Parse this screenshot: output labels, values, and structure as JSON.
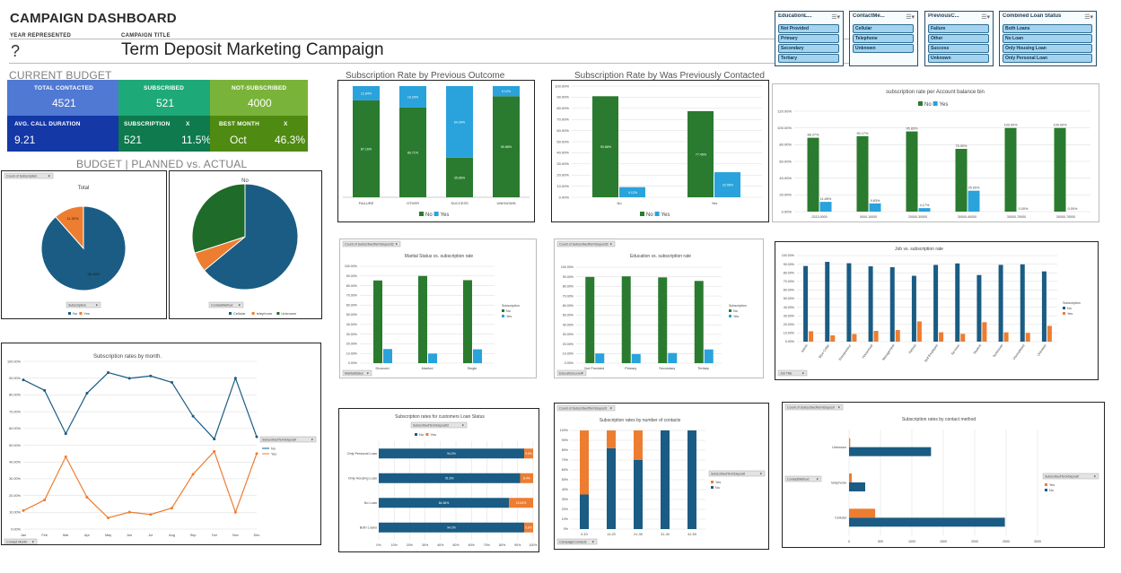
{
  "header": {
    "title": "CAMPAIGN DASHBOARD",
    "year_label": "YEAR REPRESENTED",
    "year_value": "?",
    "campaign_label": "CAMPAIGN TITLE",
    "campaign_value": "Term Deposit Marketing Campaign"
  },
  "colors": {
    "green": "#2a7b2f",
    "blue": "#2aa2db",
    "navy": "#1a5c83",
    "orange": "#ed7d31"
  },
  "current_budget": {
    "title": "CURRENT BUDGET",
    "tiles": [
      {
        "label": "TOTAL CONTACTED",
        "value": "4521"
      },
      {
        "label": "SUBSCRIBED",
        "value": "521"
      },
      {
        "label": "NOT-SUBSCRIBED",
        "value": "4000"
      },
      {
        "label": "AVG. CALL DURATION",
        "value": "9.21"
      },
      {
        "label": "SUBSCRIPTION",
        "extra": "X",
        "value": "521",
        "value2": "11.5%"
      },
      {
        "label": "BEST MONTH",
        "extra": "X",
        "value": "Oct",
        "value2": "46.3%"
      }
    ]
  },
  "budget_section": {
    "title": "BUDGET  |  PLANNED vs. ACTUAL"
  },
  "slicers": [
    {
      "title": "EducationL...",
      "items": [
        "Not Provided",
        "Primary",
        "Secondary",
        "Tertiary"
      ]
    },
    {
      "title": "ContactMe...",
      "items": [
        "Cellular",
        "Telephone",
        "Unknown"
      ]
    },
    {
      "title": "PreviousC...",
      "items": [
        "Failure",
        "Other",
        "Success",
        "Unknown"
      ]
    },
    {
      "title": "Combined Loan Status",
      "items": [
        "Both Loans",
        "No Loan",
        "Only Housing Loan",
        "Only Personal Loan"
      ]
    }
  ],
  "chart_data": [
    {
      "id": "pie-total",
      "type": "pie",
      "title": "Total",
      "field": "Count of Subscription",
      "filter": "Subscription",
      "slices": [
        {
          "name": "No",
          "value": 88.48,
          "label": "88.48%"
        },
        {
          "name": "Yes",
          "value": 11.52,
          "label": "11.52%"
        }
      ],
      "legend": [
        "No",
        "Yes"
      ]
    },
    {
      "id": "pie-no",
      "type": "pie",
      "title": "No",
      "filter": "ContactMethod",
      "slices": [
        {
          "name": "Cellular",
          "value": 64
        },
        {
          "name": "telephone",
          "value": 6
        },
        {
          "name": "Unknown",
          "value": 30
        }
      ],
      "legend": [
        "Cellular",
        "telephone",
        "Unknown"
      ]
    },
    {
      "id": "prev-outcome",
      "type": "bar",
      "stacked": true,
      "title": "Subscription Rate by Previous Outcome",
      "categories": [
        "FAILURE",
        "OTHER",
        "SUCCESS",
        "UNKNOWN"
      ],
      "series": [
        {
          "name": "No",
          "values": [
            87.16,
            80.71,
            35.66,
            90.88
          ],
          "labels": [
            "87.16%",
            "80.71%",
            "35.66%",
            "90.88%"
          ]
        },
        {
          "name": "Yes",
          "values": [
            12.84,
            19.29,
            64.34,
            9.12
          ],
          "labels": [
            "12.84%",
            "19.29%",
            "64.34%",
            "9.12%"
          ]
        }
      ],
      "ylim": [
        0,
        100
      ]
    },
    {
      "id": "prev-contacted",
      "type": "bar",
      "title": "Subscription Rate by Was Previously Contacted",
      "categories": [
        "No",
        "Yes"
      ],
      "series": [
        {
          "name": "No",
          "values": [
            90.88,
            77.45
          ],
          "labels": [
            "90.88%",
            "77.45%"
          ]
        },
        {
          "name": "Yes",
          "values": [
            9.12,
            22.55
          ],
          "labels": [
            "9.12%",
            "22.55%"
          ]
        }
      ],
      "yticks": [
        "0.00%",
        "10.00%",
        "20.00%",
        "30.00%",
        "40.00%",
        "50.00%",
        "60.00%",
        "70.00%",
        "80.00%",
        "90.00%",
        "100.00%"
      ],
      "ylim": [
        0,
        100
      ]
    },
    {
      "id": "balance-bin",
      "type": "bar",
      "title": "subscription rate per Account balance bin",
      "categories": [
        "-3313-0000",
        "0000-10000",
        "20000-30000",
        "30000-40000",
        "30000-70000",
        "30000-70000"
      ],
      "series": [
        {
          "name": "No",
          "values": [
            88.27,
            90.17,
            95.83,
            75.0,
            100.0,
            100.0
          ],
          "labels": [
            "88.27%",
            "90.17%",
            "95.83%",
            "75.00%",
            "100.00%",
            "100.00%"
          ]
        },
        {
          "name": "Yes",
          "values": [
            11.65,
            9.83,
            4.17,
            25.0,
            0.0,
            0.0
          ],
          "labels": [
            "11.65%",
            "9.83%",
            "4.17%",
            "25.00%",
            "0.00%",
            "0.00%"
          ]
        }
      ],
      "yticks": [
        "0.00%",
        "20.00%",
        "40.00%",
        "60.00%",
        "80.00%",
        "100.00%",
        "120.00%"
      ],
      "ylim": [
        0,
        120
      ]
    },
    {
      "id": "marital",
      "type": "bar",
      "title": "Marital Status vs. subscription rate",
      "field": "Count of SubscribedTermDeposit2",
      "filter": "MaritalStatus",
      "legend_title": "Subscription",
      "categories": [
        "Divorced",
        "Married",
        "Single"
      ],
      "series": [
        {
          "name": "No",
          "values": [
            85.4,
            90.1,
            85.7
          ]
        },
        {
          "name": "Yes",
          "values": [
            14.6,
            9.9,
            14.3
          ]
        }
      ],
      "yticks": [
        "0.00%",
        "10.00%",
        "20.00%",
        "30.00%",
        "40.00%",
        "50.00%",
        "60.00%",
        "70.00%",
        "80.00%",
        "90.00%",
        "100.00%"
      ],
      "ylim": [
        0,
        100
      ]
    },
    {
      "id": "education",
      "type": "bar",
      "title": "Education vs. subscription rate",
      "field": "Count of SubscribedTermDeposit2",
      "filter": "EducationLevel",
      "legend_title": "Subscription",
      "categories": [
        "Not Provided",
        "Primary",
        "Secondary",
        "Tertiary"
      ],
      "series": [
        {
          "name": "No",
          "values": [
            89.9,
            90.5,
            89.4,
            85.7
          ]
        },
        {
          "name": "Yes",
          "values": [
            10.1,
            9.5,
            10.6,
            14.3
          ]
        }
      ],
      "yticks": [
        "0.00%",
        "10.00%",
        "20.00%",
        "30.00%",
        "40.00%",
        "50.00%",
        "60.00%",
        "70.00%",
        "80.00%",
        "90.00%",
        "100.00%"
      ],
      "ylim": [
        0,
        100
      ]
    },
    {
      "id": "job",
      "type": "bar",
      "title": "Job vs. subscription rate",
      "filter": "Job Title",
      "legend_title": "Subscription",
      "categories": [
        "Admin",
        "Blue-Collar",
        "Entrepreneur",
        "Housemaid",
        "Management",
        "Retired",
        "Self-Employed",
        "Services",
        "Student",
        "Technician",
        "Unemployed",
        "Unknown"
      ],
      "series": [
        {
          "name": "No",
          "values": [
            87.9,
            92.7,
            91.1,
            87.5,
            86.5,
            76.5,
            89.1,
            90.9,
            77.4,
            89.2,
            89.8,
            81.6
          ]
        },
        {
          "name": "Yes",
          "values": [
            12.1,
            7.3,
            8.9,
            12.5,
            13.5,
            23.5,
            10.9,
            9.1,
            22.6,
            10.8,
            10.2,
            18.4
          ]
        }
      ],
      "yticks": [
        "0.00%",
        "10.00%",
        "20.00%",
        "30.00%",
        "40.00%",
        "50.00%",
        "60.00%",
        "70.00%",
        "80.00%",
        "90.00%",
        "100.00%"
      ],
      "ylim": [
        0,
        100
      ]
    },
    {
      "id": "month",
      "type": "line",
      "title": "Subscription rates by month.",
      "filter": "Contact Month",
      "legend_title": "SubscribedTermDeposit",
      "categories": [
        "Jan",
        "Feb",
        "Mar",
        "Apr",
        "May",
        "Jun",
        "Jul",
        "Aug",
        "Sep",
        "Oct",
        "Nov",
        "Dec"
      ],
      "series": [
        {
          "name": "No",
          "values": [
            89,
            82.7,
            56.9,
            81,
            93.3,
            89.9,
            91.3,
            87.5,
            67.3,
            53.7,
            90,
            55
          ]
        },
        {
          "name": "Yes",
          "values": [
            11,
            17.3,
            43.1,
            19,
            6.7,
            10.1,
            8.7,
            12.5,
            32.7,
            46.3,
            10,
            45
          ]
        }
      ],
      "yticks": [
        "0.00%",
        "10.00%",
        "20.00%",
        "30.00%",
        "40.00%",
        "50.00%",
        "60.00%",
        "70.00%",
        "80.00%",
        "90.00%",
        "100.00%"
      ],
      "ylim": [
        0,
        100
      ]
    },
    {
      "id": "loan",
      "type": "bar",
      "orientation": "horizontal",
      "stacked": true,
      "title": "Subscription rates for customers Loan Status",
      "legend_title": "SubscribedTermDeposit2",
      "categories": [
        "Only Personal Loan",
        "Only Housing Loan",
        "No Loan",
        "Both Loans"
      ],
      "series": [
        {
          "name": "No",
          "values": [
            94.2,
            91.6,
            84.36,
            94.2
          ],
          "labels": [
            "94.2%",
            "91.6%",
            "84.36%",
            "94.2%"
          ]
        },
        {
          "name": "Yes",
          "values": [
            5.8,
            8.4,
            15.64,
            5.8
          ],
          "labels": [
            "5.8%",
            "8.4%",
            "15.64%",
            "5.8%"
          ]
        }
      ],
      "xticks": [
        "0%",
        "10%",
        "20%",
        "30%",
        "40%",
        "50%",
        "60%",
        "70%",
        "80%",
        "90%",
        "100%"
      ],
      "xlim": [
        0,
        100
      ]
    },
    {
      "id": "contacts",
      "type": "bar",
      "stacked": true,
      "title": "Subscription rates by number of contacts",
      "field": "Count of SubscribedTermDeposit",
      "filter": "CampaignContacts",
      "legend_title": "SubscribedTermDeposit",
      "categories": [
        "0-10",
        "11-20",
        "21-30",
        "31-40",
        "41-50"
      ],
      "series": [
        {
          "name": "No",
          "values": [
            35,
            82,
            70,
            100,
            100
          ]
        },
        {
          "name": "Yes",
          "values": [
            65,
            18,
            30,
            0,
            0
          ]
        }
      ],
      "legend": [
        "Yes",
        "No"
      ],
      "yticks": [
        "0%",
        "10%",
        "20%",
        "30%",
        "40%",
        "50%",
        "60%",
        "70%",
        "80%",
        "90%",
        "100%"
      ],
      "ylim": [
        0,
        100
      ]
    },
    {
      "id": "contact-method",
      "type": "bar",
      "orientation": "horizontal",
      "title": "Subscription rates by contact method",
      "field": "Count of SubscribedTermDeposit",
      "filter": "ContactMethod",
      "legend_title": "SubscribedTermDeposit",
      "categories": [
        "Unknown",
        "telephone",
        "Cellular"
      ],
      "series": [
        {
          "name": "Yes",
          "values": [
            19,
            44,
            416
          ]
        },
        {
          "name": "No",
          "values": [
            1305,
            257,
            2480
          ]
        }
      ],
      "legend": [
        "Yes",
        "No"
      ],
      "xticks": [
        "0",
        "500",
        "1000",
        "1500",
        "2000",
        "2500",
        "3000"
      ],
      "xlim": [
        0,
        3000
      ]
    }
  ]
}
